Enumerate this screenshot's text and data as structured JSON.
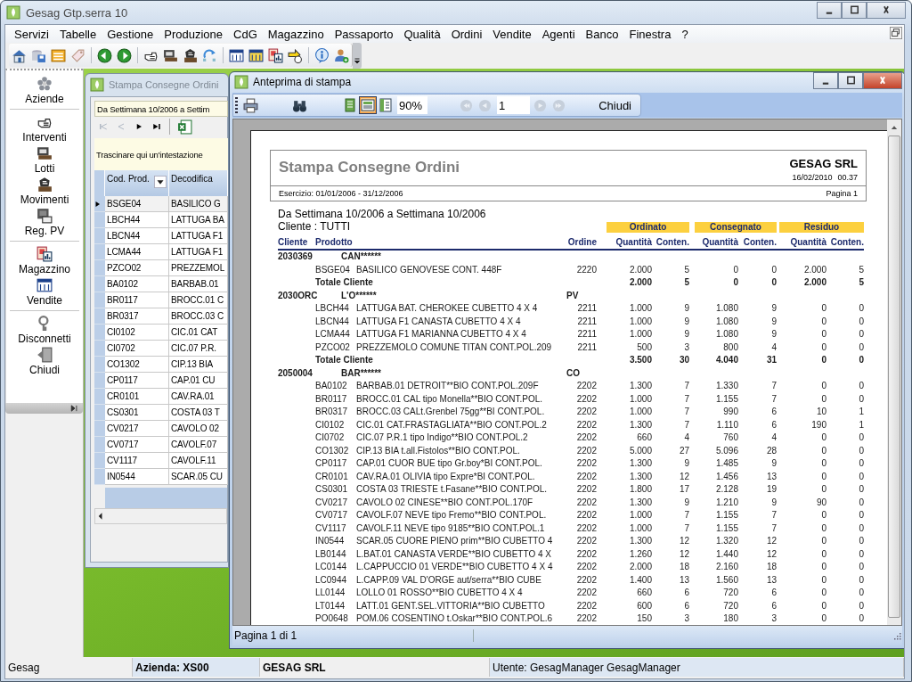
{
  "window": {
    "title": "Gesag Gtp.serra 10"
  },
  "menu": [
    "Servizi",
    "Tabelle",
    "Gestione",
    "Produzione",
    "CdG",
    "Magazzino",
    "Passaporto",
    "Qualità",
    "Ordini",
    "Vendite",
    "Agenti",
    "Banco",
    "Finestra",
    "?"
  ],
  "sidebar": {
    "groups": [
      [
        "Aziende"
      ],
      [
        "Interventi",
        "Lotti",
        "Movimenti",
        "Reg. PV"
      ],
      [
        "Magazzino",
        "Vendite"
      ],
      [
        "Disconnetti",
        "Chiudi"
      ]
    ]
  },
  "back_window": {
    "title": "Stampa Consegne Ordini",
    "filter": "Da Settimana 10/2006 a Settim",
    "nav": [
      {
        "disabled": true
      },
      {
        "disabled": true
      },
      {
        "disabled": false
      },
      {
        "disabled": false
      }
    ],
    "group_hint": "Trascinare qui un'intestazione",
    "columns": [
      "Cod. Prod.",
      "Decodifica"
    ],
    "rows": [
      {
        "cells": [
          "BSGE04",
          "BASILICO G"
        ],
        "selected": true
      },
      {
        "cells": [
          "LBCH44",
          "LATTUGA BA"
        ],
        "selected": false
      },
      {
        "cells": [
          "LBCN44",
          "LATTUGA F1"
        ],
        "selected": false
      },
      {
        "cells": [
          "LCMA44",
          "LATTUGA F1"
        ],
        "selected": false
      },
      {
        "cells": [
          "PZCO02",
          "PREZZEMOL"
        ],
        "selected": false
      },
      {
        "cells": [
          "BA0102",
          "BARBAB.01"
        ],
        "selected": false
      },
      {
        "cells": [
          "BR0117",
          "BROCC.01 C"
        ],
        "selected": false
      },
      {
        "cells": [
          "BR0317",
          "BROCC.03 C"
        ],
        "selected": false
      },
      {
        "cells": [
          "CI0102",
          "CIC.01 CAT"
        ],
        "selected": false
      },
      {
        "cells": [
          "CI0702",
          "CIC.07 P.R."
        ],
        "selected": false
      },
      {
        "cells": [
          "CO1302",
          "CIP.13 BIA"
        ],
        "selected": false
      },
      {
        "cells": [
          "CP0117",
          "CAP.01 CU"
        ],
        "selected": false
      },
      {
        "cells": [
          "CR0101",
          "CAV.RA.01"
        ],
        "selected": false
      },
      {
        "cells": [
          "CS0301",
          "COSTA 03 T"
        ],
        "selected": false
      },
      {
        "cells": [
          "CV0217",
          "CAVOLO 02"
        ],
        "selected": false
      },
      {
        "cells": [
          "CV0717",
          "CAVOLF.07"
        ],
        "selected": false
      },
      {
        "cells": [
          "CV1117",
          "CAVOLF.11"
        ],
        "selected": false
      },
      {
        "cells": [
          "IN0544",
          "SCAR.05 CU"
        ],
        "selected": false
      }
    ]
  },
  "preview_window": {
    "title": "Anteprima di stampa",
    "view_modes": [
      {
        "selected": false
      },
      {
        "selected": true
      },
      {
        "selected": false
      }
    ],
    "zoom": "90%",
    "nav": [
      {
        "disabled": true
      },
      {
        "disabled": true
      },
      {
        "disabled": true
      },
      {
        "disabled": true
      }
    ],
    "page": "1",
    "close_label": "Chiudi",
    "status": "Pagina 1 di 1",
    "report": {
      "title": "Stampa Consegne Ordini",
      "company": "GESAG SRL",
      "date": "16/02/2010",
      "time": "00.37",
      "period": "Esercizio: 01/01/2006 - 31/12/2006",
      "page": "Pagina 1",
      "range": "Da Settimana 10/2006 a Settimana 10/2006",
      "client_filter": "Cliente : TUTTI",
      "bands": [
        "Ordinato",
        "Consegnato",
        "Residuo"
      ],
      "columns": [
        "Cliente",
        "Prodotto",
        "Ordine",
        "Quantità",
        "Conten.",
        "Quantità",
        "Conten.",
        "Quantità",
        "Conten."
      ],
      "groups": [
        {
          "client": "2030369",
          "name": "CAN******",
          "rows": [
            [
              "BSGE04",
              "BASILICO GENOVESE CONT. 448F",
              "2220",
              "2.000",
              "5",
              "0",
              "0",
              "2.000",
              "5"
            ]
          ],
          "total": [
            "Totale Cliente",
            "2.000",
            "5",
            "0",
            "0",
            "2.000",
            "5"
          ]
        },
        {
          "client": "2030ORC",
          "name": "L'O******",
          "type": "PV",
          "rows": [
            [
              "LBCH44",
              "LATTUGA BAT. CHEROKEE CUBETTO 4 X 4",
              "2211",
              "1.000",
              "9",
              "1.080",
              "9",
              "0",
              "0"
            ],
            [
              "LBCN44",
              "LATTUGA F1 CANASTA CUBETTO 4 X 4",
              "2211",
              "1.000",
              "9",
              "1.080",
              "9",
              "0",
              "0"
            ],
            [
              "LCMA44",
              "LATTUGA F1 MARIANNA CUBETTO 4 X 4",
              "2211",
              "1.000",
              "9",
              "1.080",
              "9",
              "0",
              "0"
            ],
            [
              "PZCO02",
              "PREZZEMOLO COMUNE TITAN CONT.POL.209",
              "2211",
              "500",
              "3",
              "800",
              "4",
              "0",
              "0"
            ]
          ],
          "total": [
            "Totale Cliente",
            "3.500",
            "30",
            "4.040",
            "31",
            "0",
            "0"
          ]
        },
        {
          "client": "2050004",
          "name": "BAR******",
          "type": "CO",
          "rows": [
            [
              "BA0102",
              "BARBAB.01 DETROIT**BIO CONT.POL.209F",
              "2202",
              "1.300",
              "7",
              "1.330",
              "7",
              "0",
              "0"
            ],
            [
              "BR0117",
              "BROCC.01 CAL tipo Monella**BIO CONT.POL.",
              "2202",
              "1.000",
              "7",
              "1.155",
              "7",
              "0",
              "0"
            ],
            [
              "BR0317",
              "BROCC.03 CALt.Grenbel 75gg**BI CONT.POL.",
              "2202",
              "1.000",
              "7",
              "990",
              "6",
              "10",
              "1"
            ],
            [
              "CI0102",
              "CIC.01 CAT.FRASTAGLIATA**BIO CONT.POL.2",
              "2202",
              "1.300",
              "7",
              "1.110",
              "6",
              "190",
              "1"
            ],
            [
              "CI0702",
              "CIC.07 P.R.1 tipo Indigo**BIO CONT.POL.2",
              "2202",
              "660",
              "4",
              "760",
              "4",
              "0",
              "0"
            ],
            [
              "CO1302",
              "CIP.13 BIA t.all.Fistolos**BIO CONT.POL.",
              "2202",
              "5.000",
              "27",
              "5.096",
              "28",
              "0",
              "0"
            ],
            [
              "CP0117",
              "CAP.01 CUOR BUE tipo Gr.boy*BI CONT.POL.",
              "2202",
              "1.300",
              "9",
              "1.485",
              "9",
              "0",
              "0"
            ],
            [
              "CR0101",
              "CAV.RA.01 OLIVIA tipo Expre*BI CONT.POL.",
              "2202",
              "1.300",
              "12",
              "1.456",
              "13",
              "0",
              "0"
            ],
            [
              "CS0301",
              "COSTA 03 TRIESTE t.Fasane**BIO CONT.POL.",
              "2202",
              "1.800",
              "17",
              "2.128",
              "19",
              "0",
              "0"
            ],
            [
              "CV0217",
              "CAVOLO 02 CINESE**BIO CONT.POL.170F",
              "2202",
              "1.300",
              "9",
              "1.210",
              "9",
              "90",
              "0"
            ],
            [
              "CV0717",
              "CAVOLF.07 NEVE tipo Fremo**BIO CONT.POL.",
              "2202",
              "1.000",
              "7",
              "1.155",
              "7",
              "0",
              "0"
            ],
            [
              "CV1117",
              "CAVOLF.11 NEVE tipo 9185**BIO CONT.POL.1",
              "2202",
              "1.000",
              "7",
              "1.155",
              "7",
              "0",
              "0"
            ],
            [
              "IN0544",
              "SCAR.05 CUORE PIENO prim**BIO CUBETTO 4",
              "2202",
              "1.300",
              "12",
              "1.320",
              "12",
              "0",
              "0"
            ],
            [
              "LB0144",
              "L.BAT.01 CANASTA VERDE**BIO CUBETTO 4 X",
              "2202",
              "1.260",
              "12",
              "1.440",
              "12",
              "0",
              "0"
            ],
            [
              "LC0144",
              "L.CAPPUCCIO 01 VERDE**BIO CUBETTO 4 X 4",
              "2202",
              "2.000",
              "18",
              "2.160",
              "18",
              "0",
              "0"
            ],
            [
              "LC0944",
              "L.CAPP.09 VAL D'ORGE aut/serra**BIO CUBE",
              "2202",
              "1.400",
              "13",
              "1.560",
              "13",
              "0",
              "0"
            ],
            [
              "LL0144",
              "LOLLO 01 ROSSO**BIO CUBETTO 4 X 4",
              "2202",
              "660",
              "6",
              "720",
              "6",
              "0",
              "0"
            ],
            [
              "LT0144",
              "LATT.01 GENT.SEL.VITTORIA**BIO CUBETTO",
              "2202",
              "600",
              "6",
              "720",
              "6",
              "0",
              "0"
            ],
            [
              "PO0648",
              "POM.06 COSENTINO t.Oskar**BIO CONT.POL.6",
              "2202",
              "150",
              "3",
              "180",
              "3",
              "0",
              "0"
            ]
          ]
        }
      ]
    }
  },
  "status_bar": [
    {
      "text": "Gesag",
      "bold": false
    },
    {
      "text": "Azienda: XS00",
      "bold": true
    },
    {
      "text": "GESAG SRL",
      "bold": true
    },
    {
      "text": "Utente: GesagManager GesagManager",
      "bold": false
    }
  ]
}
